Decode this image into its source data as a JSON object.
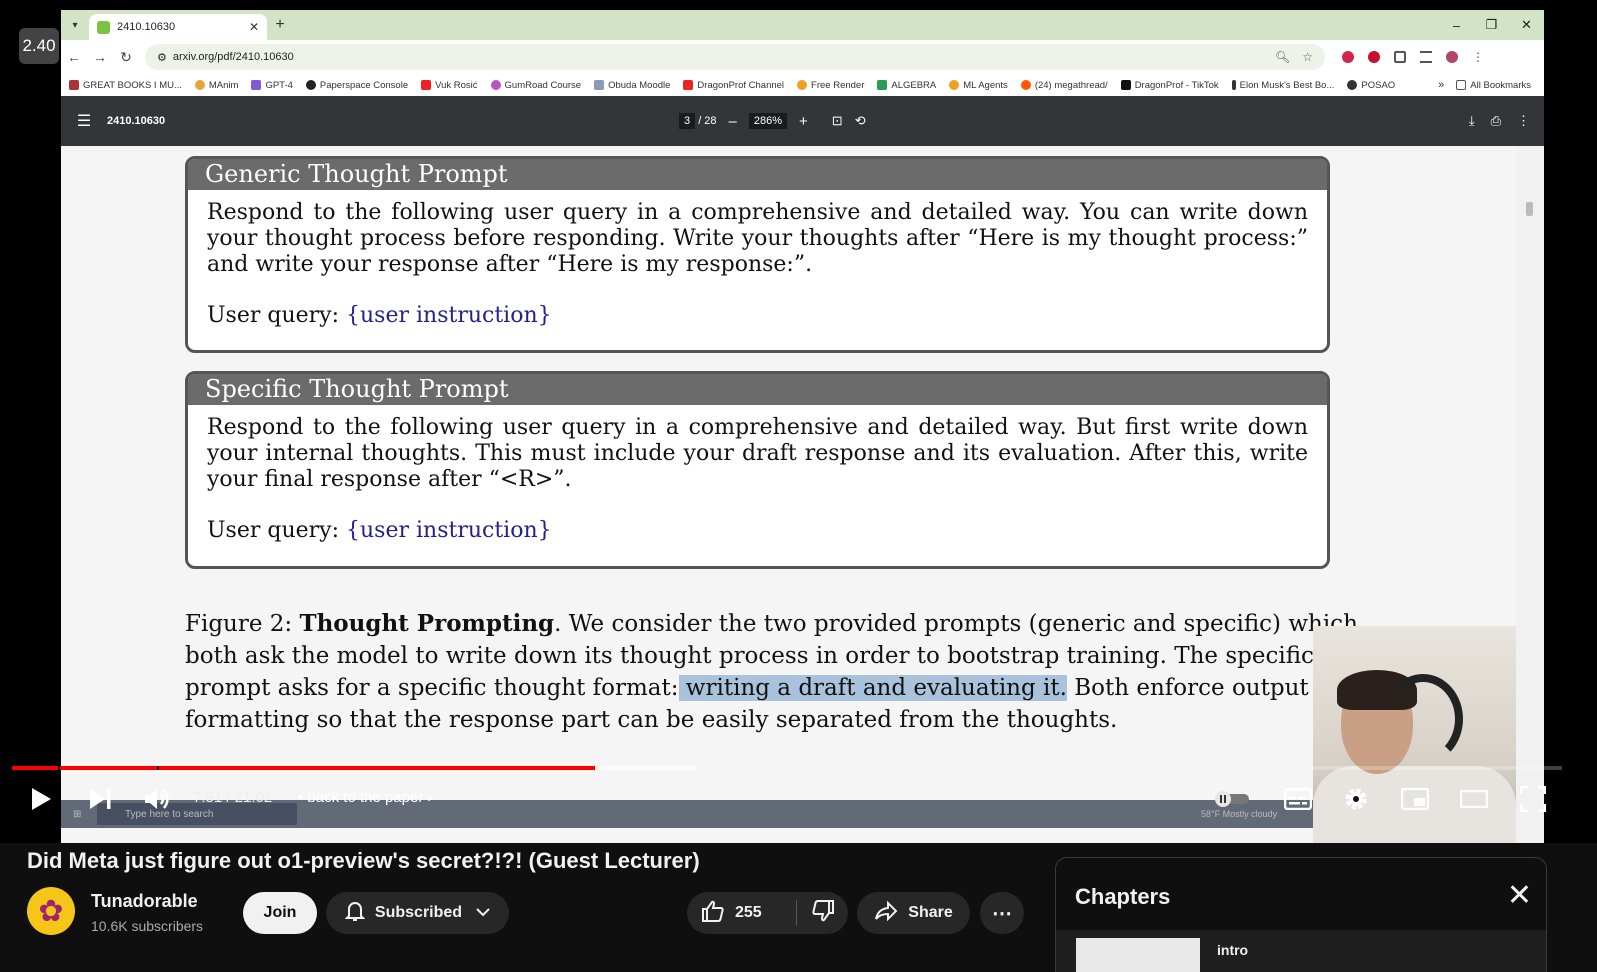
{
  "browser": {
    "tab_title": "2410.10630",
    "url": "arxiv.org/pdf/2410.10630",
    "playback_speed": "2.40",
    "bookmarks": [
      "GREAT BOOKS I MU...",
      "MAnim",
      "GPT-4",
      "Paperspace Console",
      "Vuk Rosić",
      "GumRoad Course",
      "Obuda Moodle",
      "DragonProf Channel",
      "Free Render",
      "ALGEBRA",
      "ML Agents",
      "(24) megathread/",
      "DragonProf - TikTok",
      "Elon Musk's Best Bo...",
      "POSAO"
    ],
    "bookmarks_more": "»",
    "all_bookmarks": "All Bookmarks"
  },
  "pdf": {
    "doc_title": "2410.10630",
    "page_current": "3",
    "page_total": "/ 28",
    "zoom": "286%",
    "generic": {
      "header": "Generic Thought Prompt",
      "body": "Respond to the following user query in a comprehensive and detailed way.  You can write down your thought process before responding. Write your thoughts after “Here is my thought process:” and write your response after “Here is my response:”.",
      "query_label": "User query:",
      "query_value": "{user instruction}"
    },
    "specific": {
      "header": "Specific Thought Prompt",
      "body": "Respond to the following user query in a comprehensive and detailed way. But first write down your internal thoughts. This must include your draft response and its evaluation.  After this, write your final response after “<R>”.",
      "query_label": "User query:",
      "query_value": "{user instruction}"
    },
    "caption": {
      "fig": "Figure 2:",
      "bold": "Thought Prompting",
      "line1_rest": ". We consider the two provided prompts (generic and specific) which",
      "line2": "both ask the model to write down its thought process in order to bootstrap training.  The specific",
      "line3_pre": "prompt asks for a specific thought format:",
      "line3_hl": " writing a draft and evaluating it.",
      "line3_post": " Both enforce output",
      "line4": "formatting so that the response part can be easily separated from the thoughts."
    }
  },
  "taskbar": {
    "search_placeholder": "Type here to search",
    "weather": "58°F  Mostly cloudy"
  },
  "player": {
    "time": "7:51 / 21:02",
    "chapter": "•  back to the paper",
    "progress_played": 0.376,
    "progress_buffered": 0.441
  },
  "video": {
    "title": "Did Meta just figure out o1-preview's secret?!?! (Guest Lecturer)",
    "channel": "Tunadorable",
    "subscribers": "10.6K subscribers",
    "join": "Join",
    "subscribed": "Subscribed",
    "likes": "255",
    "share": "Share"
  },
  "chapters": {
    "title": "Chapters",
    "first": "intro"
  },
  "colors": {
    "accent_red": "#ff0000",
    "highlight": "#a9c3dc",
    "link_blue": "#22228a"
  }
}
